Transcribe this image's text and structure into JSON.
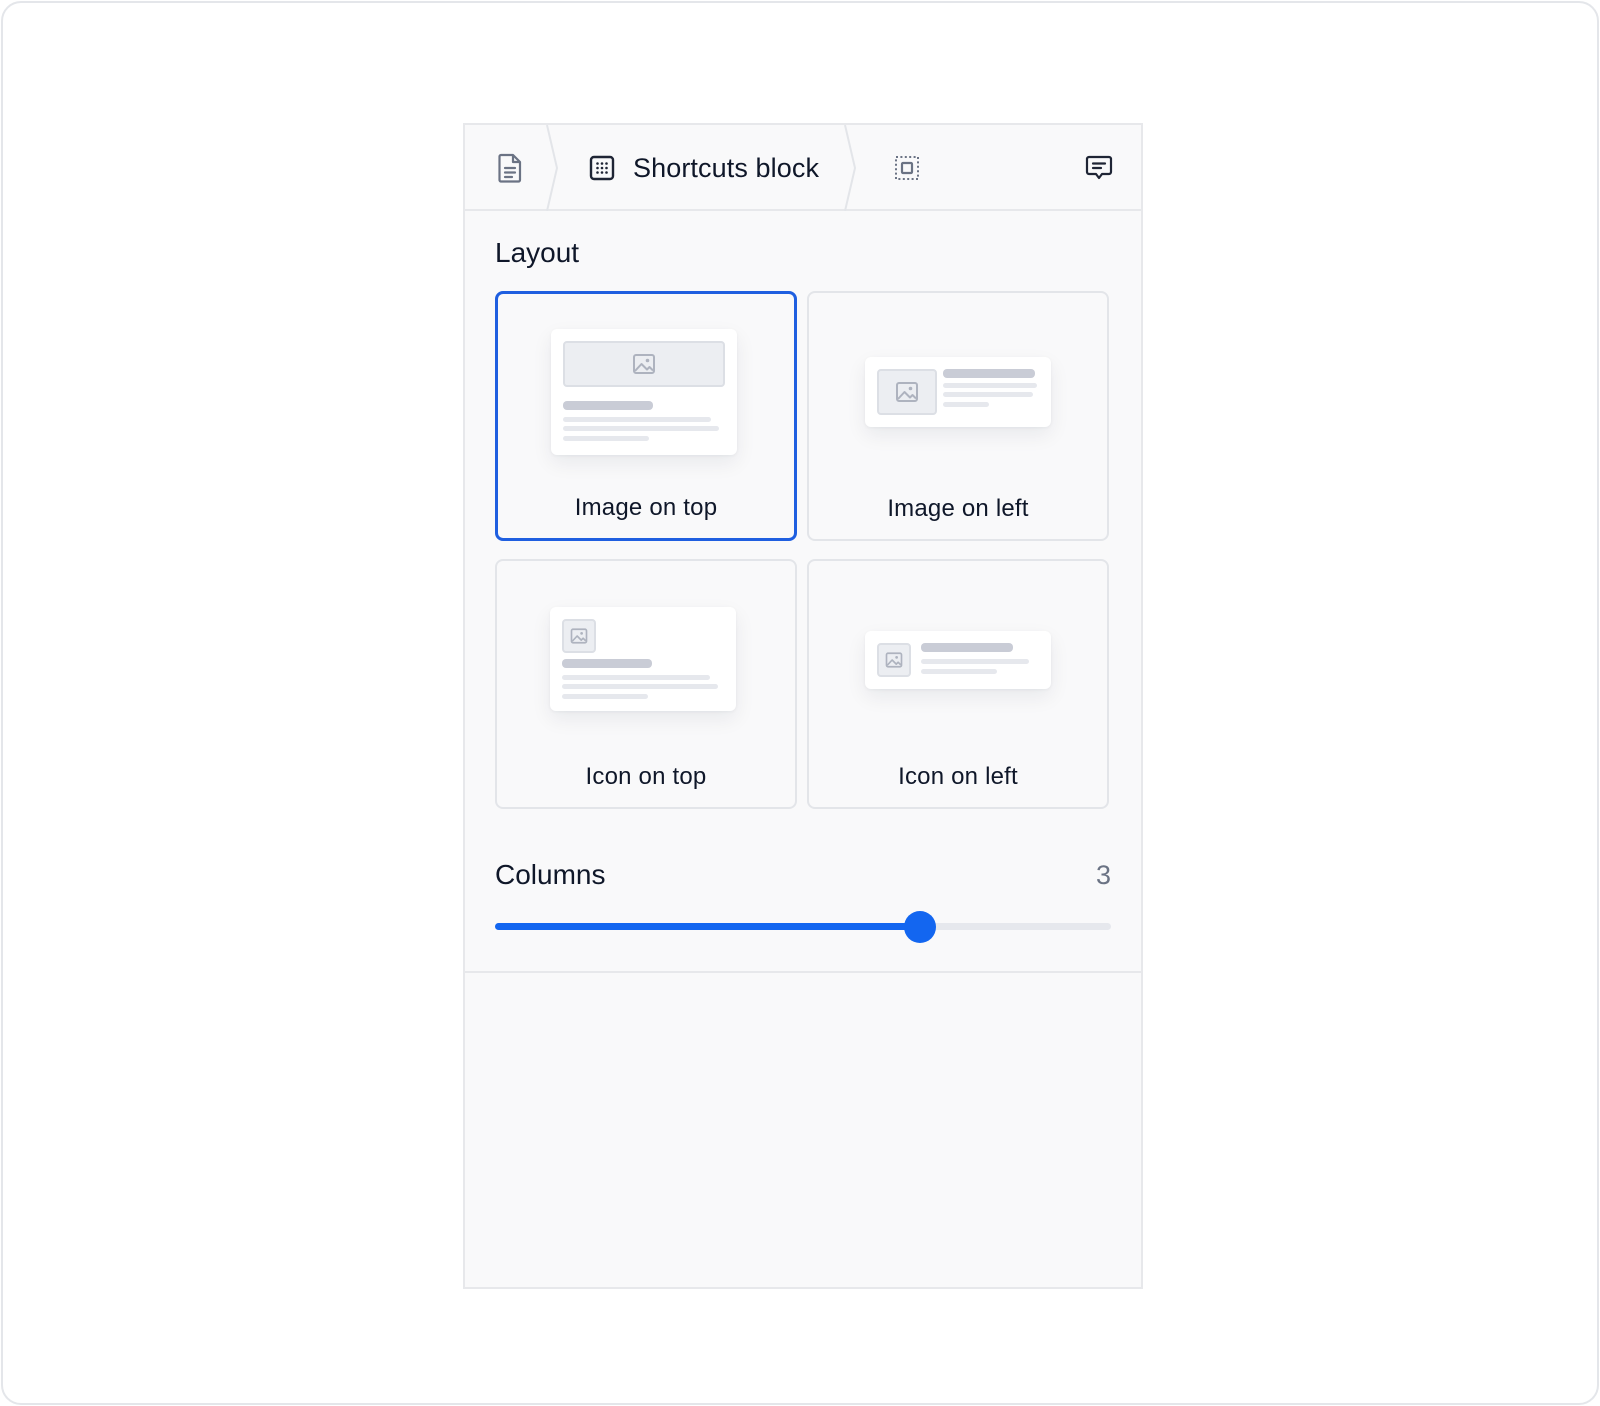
{
  "breadcrumb": {
    "page_icon": "document-icon",
    "block_icon": "grid-dots-icon",
    "title": "Shortcuts block",
    "select_parent_icon": "select-frame-icon",
    "comment_icon": "comment-icon"
  },
  "layout": {
    "heading": "Layout",
    "options": [
      {
        "label": "Image on top",
        "selected": true
      },
      {
        "label": "Image on left",
        "selected": false
      },
      {
        "label": "Icon on top",
        "selected": false
      },
      {
        "label": "Icon on left",
        "selected": false
      }
    ]
  },
  "columns": {
    "heading": "Columns",
    "value": "3",
    "slider_fraction": 0.69
  },
  "colors": {
    "accent": "#1366f0",
    "selected_border": "#1f5fe0",
    "panel_bg": "#f9f9fa"
  }
}
